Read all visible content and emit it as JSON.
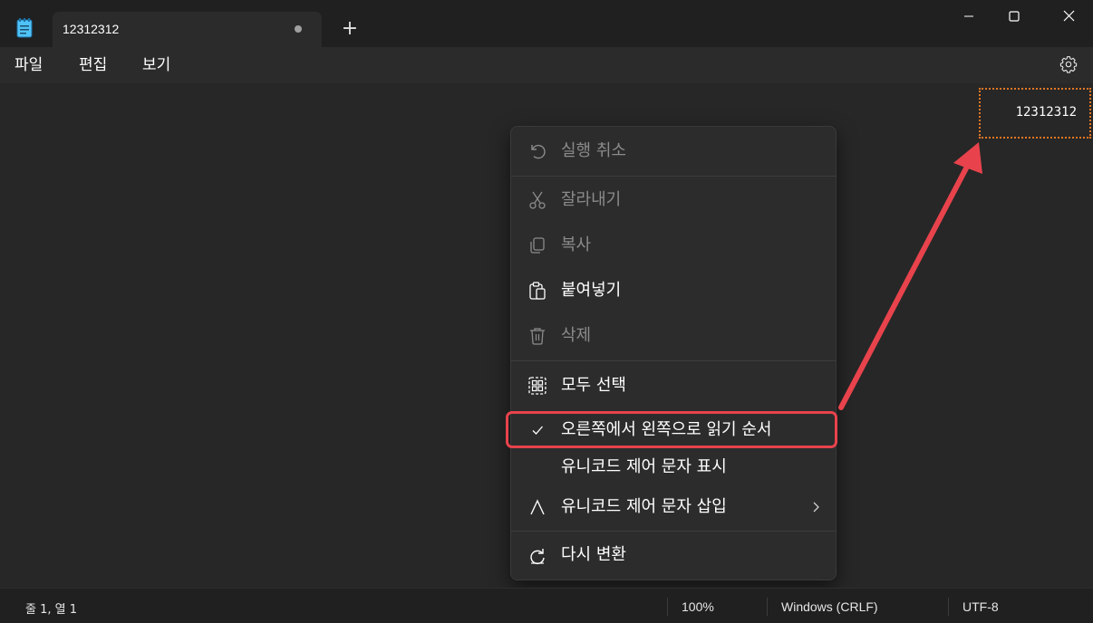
{
  "window": {
    "tab_title": "12312312",
    "new_tab_symbol": "+",
    "icons": [
      "notepad-icon",
      "unsaved-dot-icon",
      "plus-icon",
      "minimize-icon",
      "maximize-icon",
      "close-icon",
      "gear-icon"
    ]
  },
  "menubar": {
    "file": "파일",
    "edit": "편집",
    "view": "보기"
  },
  "editor": {
    "text": "12312312"
  },
  "context_menu": {
    "items": [
      {
        "label": "실행 취소",
        "icon": "undo-icon",
        "enabled": false
      },
      {
        "label": "잘라내기",
        "icon": "scissors-icon",
        "enabled": false
      },
      {
        "label": "복사",
        "icon": "copy-icon",
        "enabled": false
      },
      {
        "label": "붙여넣기",
        "icon": "paste-icon",
        "enabled": true
      },
      {
        "label": "삭제",
        "icon": "trash-icon",
        "enabled": false
      },
      {
        "label": "모두 선택",
        "icon": "select-all-icon",
        "enabled": true
      },
      {
        "label": "오른쪽에서 왼쪽으로 읽기 순서",
        "icon": "check-icon",
        "enabled": true,
        "checked": true
      },
      {
        "label": "유니코드 제어 문자 표시",
        "icon": "",
        "enabled": true
      },
      {
        "label": "유니코드 제어 문자 삽입",
        "icon": "unicode-insert-icon",
        "enabled": true,
        "submenu": true
      },
      {
        "label": "다시 변환",
        "icon": "reconvert-icon",
        "enabled": true
      }
    ]
  },
  "statusbar": {
    "position": "줄 1, 열 1",
    "zoom": "100%",
    "line_ending": "Windows (CRLF)",
    "encoding": "UTF-8"
  },
  "colors": {
    "annotation_red": "#e8434c",
    "selection_orange": "#e87722",
    "background": "#202020"
  }
}
